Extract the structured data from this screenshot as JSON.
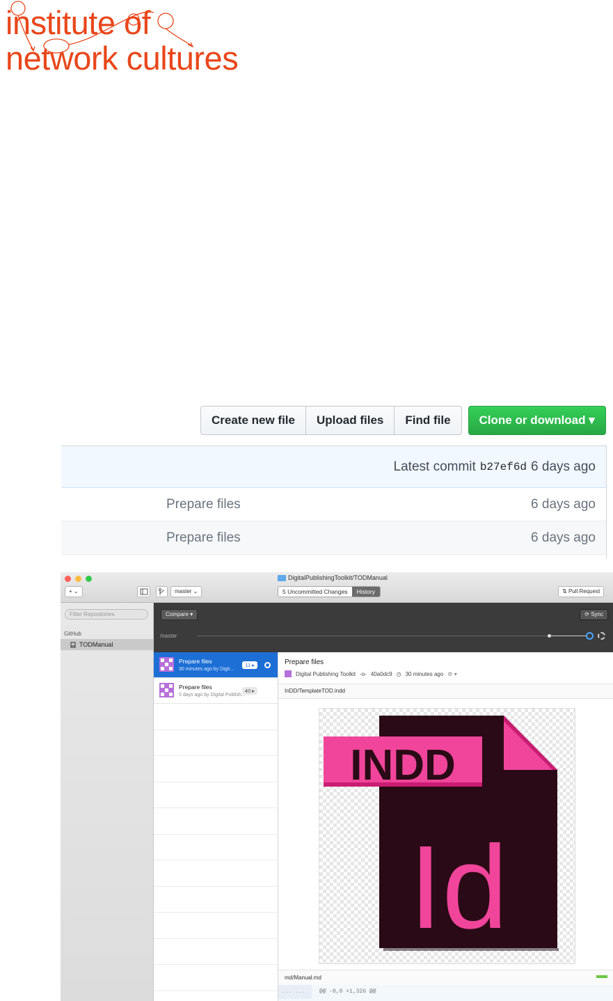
{
  "logo": {
    "line1": "institute of",
    "line2": "network cultures",
    "color": "#e8471b"
  },
  "github_web": {
    "buttons": [
      "Create new file",
      "Upload files",
      "Find file"
    ],
    "clone_button": "Clone or download ▾",
    "latest_commit_label": "Latest commit",
    "latest_commit_sha": "b27ef6d",
    "latest_commit_age": "6 days ago",
    "rows": [
      {
        "message": "Prepare files",
        "age": "6 days ago"
      },
      {
        "message": "Prepare files",
        "age": "6 days ago"
      }
    ],
    "accent_green": "#28a745"
  },
  "desktop_app": {
    "window_title": "DigitalPublishingToolkit/TODManual",
    "add_button": "+ ⌄",
    "branch": "master ⌄",
    "tabs": {
      "changes": "5 Uncommitted Changes",
      "history": "History"
    },
    "pull_request": "Pull Request",
    "sidebar": {
      "filter_placeholder": "Filter Repositories",
      "section": "GitHub",
      "repo": "TODManual"
    },
    "compare_button": "Compare ▾",
    "sync_button": "Sync",
    "branch_label": "master",
    "commits": [
      {
        "title": "Prepare files",
        "subtitle": "30 minutes ago by Digit...",
        "count": "11 ▸",
        "selected": true
      },
      {
        "title": "Prepare files",
        "subtitle": "5 days ago by Digital Publish...",
        "count": "40 ▸",
        "selected": false
      }
    ],
    "detail": {
      "title": "Prepare files",
      "author": "Digital Publishing Toolkit",
      "sha": "40a0dc9",
      "time": "30 minutes ago",
      "file1": "InDD/TemplateTOD.indd",
      "file2": "md/Manual.md",
      "hunk_gutter": "... ...",
      "hunk": "@@ -0,0 +1,326 @@"
    },
    "indd_icon": {
      "banner_text": "INDD",
      "logo_text": "Id",
      "banner_color": "#f0459a",
      "page_color": "#2a0a16"
    },
    "accent_blue": "#1d6fd6"
  }
}
